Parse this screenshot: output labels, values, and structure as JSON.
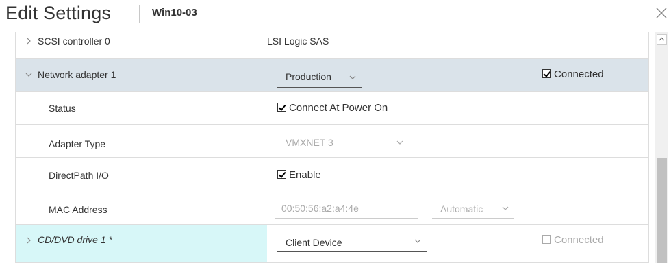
{
  "header": {
    "title": "Edit Settings",
    "vm_name": "Win10-03"
  },
  "rows": {
    "scsi": {
      "label": "SCSI controller 0",
      "value": "LSI Logic SAS"
    },
    "network": {
      "label": "Network adapter 1",
      "network_select": "Production",
      "connected_label": "Connected",
      "connected_checked": true
    },
    "status": {
      "label": "Status",
      "check_label": "Connect At Power On",
      "checked": true
    },
    "adapter_type": {
      "label": "Adapter Type",
      "value": "VMXNET 3"
    },
    "directpath": {
      "label": "DirectPath I/O",
      "check_label": "Enable",
      "checked": true
    },
    "mac": {
      "label": "MAC Address",
      "value": "00:50:56:a2:a4:4e",
      "mode": "Automatic"
    },
    "cdrom": {
      "label": "CD/DVD drive 1 *",
      "select": "Client Device",
      "connected_label": "Connected",
      "connected_checked": false
    }
  },
  "colors": {
    "network_row_bg": "#dae3ea",
    "cdrom_label_bg": "#d7f7f8",
    "border": "#dddddd",
    "disabled_text": "#aaaaaa"
  },
  "icons": {
    "close": "close-icon",
    "collapsed": "chevron-right-icon",
    "expanded": "chevron-down-icon",
    "dropdown": "chevron-down-icon",
    "scroll_up": "arrow-up-icon"
  }
}
